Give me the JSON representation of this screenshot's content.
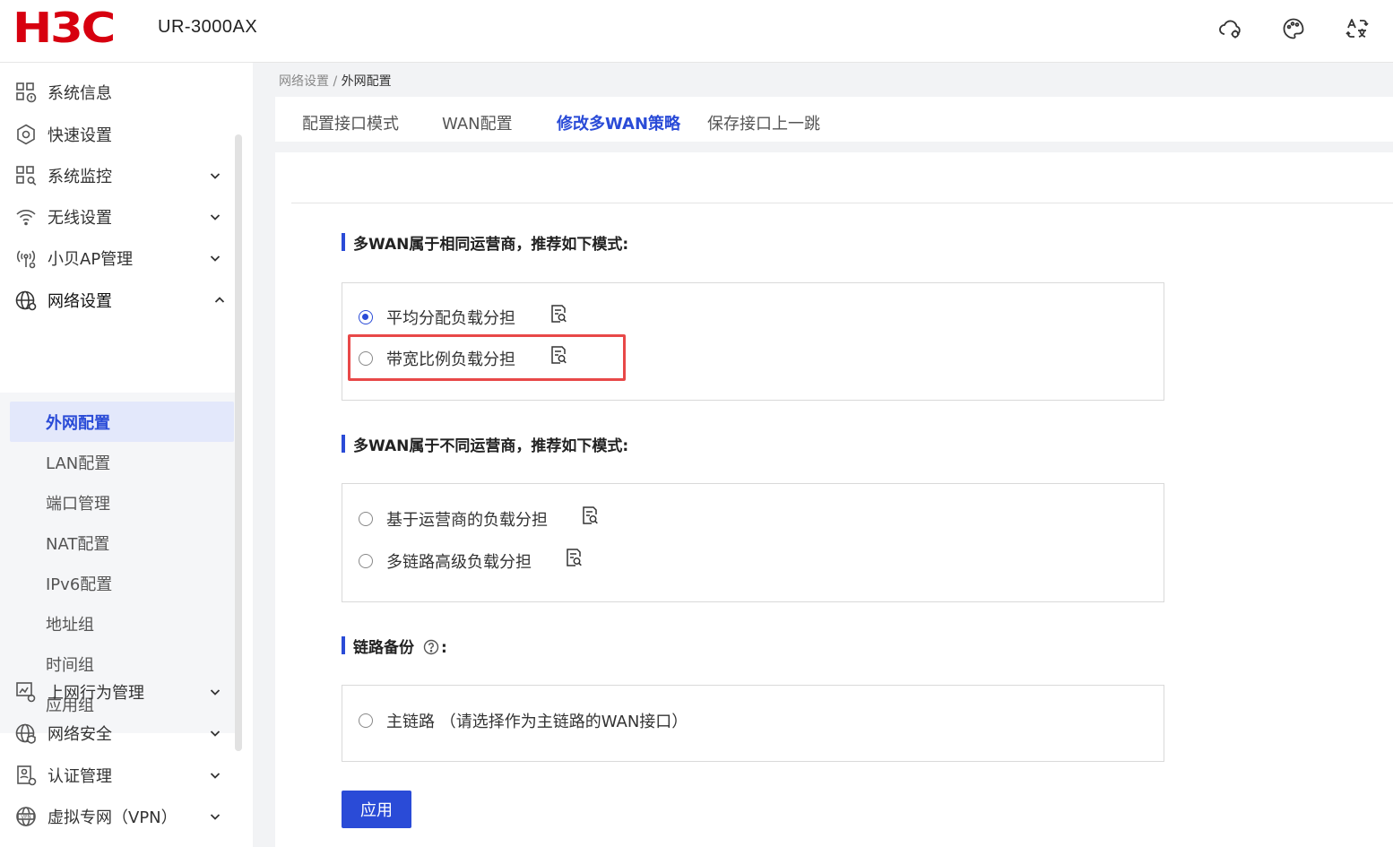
{
  "header": {
    "brand": "H3C",
    "model": "UR-3000AX",
    "icons": [
      "cloud-gear-icon",
      "palette-icon",
      "translate-icon"
    ]
  },
  "sidebar": {
    "items": [
      {
        "label": "系统信息",
        "icon": "system-info-icon"
      },
      {
        "label": "快速设置",
        "icon": "quick-setup-icon"
      },
      {
        "label": "系统监控",
        "icon": "system-monitor-icon",
        "expandable": true
      },
      {
        "label": "无线设置",
        "icon": "wifi-icon",
        "expandable": true
      },
      {
        "label": "小贝AP管理",
        "icon": "ap-manage-icon",
        "expandable": true
      },
      {
        "label": "网络设置",
        "icon": "network-globe-icon",
        "expanded": true
      },
      {
        "label": "上网行为管理",
        "icon": "behavior-manage-icon",
        "expandable": true
      },
      {
        "label": "网络安全",
        "icon": "network-security-icon",
        "expandable": true
      },
      {
        "label": "认证管理",
        "icon": "auth-manage-icon",
        "expandable": true
      },
      {
        "label": "虚拟专网（VPN）",
        "icon": "vpn-icon",
        "expandable": true
      }
    ],
    "subitems": [
      {
        "label": "外网配置",
        "active": true
      },
      {
        "label": "LAN配置"
      },
      {
        "label": "端口管理"
      },
      {
        "label": "NAT配置"
      },
      {
        "label": "IPv6配置"
      },
      {
        "label": "地址组"
      },
      {
        "label": "时间组"
      },
      {
        "label": "应用组"
      }
    ]
  },
  "breadcrumb": {
    "parent": "网络设置",
    "separator": " / ",
    "current": "外网配置"
  },
  "tabs": [
    {
      "label": "配置接口模式"
    },
    {
      "label": "WAN配置"
    },
    {
      "label": "修改多WAN策略",
      "active": true
    },
    {
      "label": "保存接口上一跳"
    }
  ],
  "sections": {
    "same_isp": {
      "title": "多WAN属于相同运营商，推荐如下模式:",
      "options": [
        {
          "label": "平均分配负载分担",
          "checked": true
        },
        {
          "label": "带宽比例负载分担",
          "checked": false
        }
      ]
    },
    "diff_isp": {
      "title": "多WAN属于不同运营商，推荐如下模式:",
      "options": [
        {
          "label": "基于运营商的负载分担",
          "checked": false
        },
        {
          "label": "多链路高级负载分担",
          "checked": false
        }
      ]
    },
    "backup": {
      "title": "链路备份",
      "suffix": ":",
      "options": [
        {
          "label": "主链路 （请选择作为主链路的WAN接口）",
          "checked": false
        }
      ]
    }
  },
  "apply_label": "应用",
  "colors": {
    "brand": "#d7000f",
    "accent": "#2a4bd7",
    "highlight": "#e84848"
  }
}
